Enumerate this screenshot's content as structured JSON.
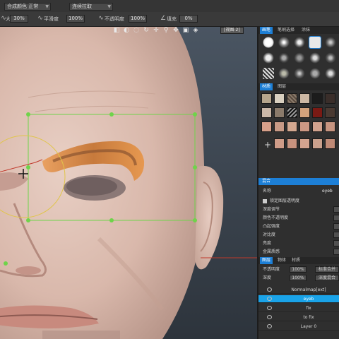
{
  "toolbar": {
    "row1": {
      "combo1": "合成颜色 正常",
      "combo2": "连续拉取"
    },
    "row2": {
      "size_label": "大小",
      "size_value": "30%",
      "smooth_label": "平滑度",
      "smooth_value": "100%",
      "opacity_label": "不透明度",
      "opacity_value": "100%",
      "fill_label": "填充",
      "fill_value": "0%"
    }
  },
  "viewport": {
    "view_label": "[视图-2]",
    "tool_icons": [
      "select-icon",
      "brush-icon",
      "lasso-icon",
      "rotate-icon",
      "move-icon",
      "zoom-icon",
      "pan-icon",
      "frame-icon",
      "cube-icon"
    ]
  },
  "panel": {
    "brush_tabs": [
      "画笔",
      "笔刷选择",
      "涂抹"
    ],
    "material_tabs": [
      "材质",
      "图层"
    ],
    "blend_section": {
      "title": "混合",
      "name_label": "名称",
      "name_value": "eyeb",
      "lock_label": "锁定图层透明度",
      "props": [
        "深度调节",
        "颜色不透明度",
        "凸起强度",
        "对比度",
        "亮度",
        "金属质感"
      ]
    },
    "layer_tabs": [
      "图层",
      "物体",
      "材质"
    ],
    "layer_opacity_label": "不透明度",
    "layer_opacity_value": "100%",
    "layer_depth_label": "深度",
    "layer_depth_value": "100%",
    "layer_btn1": "标准合并",
    "layer_btn2": "深度混合",
    "layers": [
      "Normalmap[ext]",
      "eyeb",
      "fix",
      "to fix",
      "Layer 0"
    ],
    "selected_layer": "eyeb"
  },
  "colors": {
    "accent": "#1aa3e8",
    "gizmo_green": "#6fd34a",
    "circle_yellow": "#e0c54a",
    "brush_orange": "#e08a3a"
  }
}
